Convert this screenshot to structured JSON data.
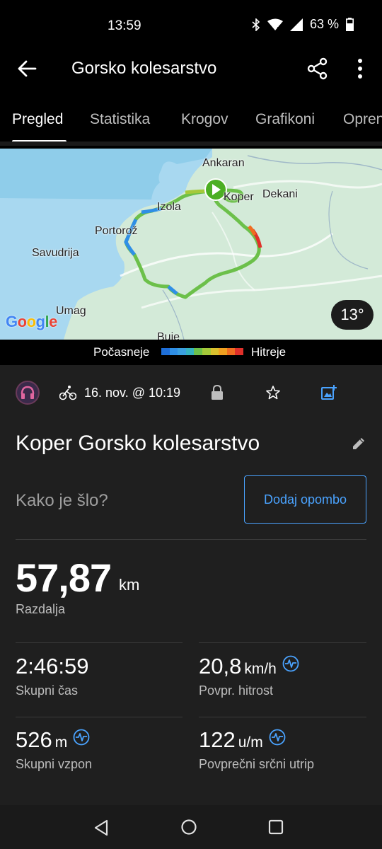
{
  "status_bar": {
    "time": "13:59",
    "battery": "63 %",
    "icons": [
      "bluetooth-icon",
      "wifi-icon",
      "signal-icon",
      "battery-icon"
    ]
  },
  "app_bar": {
    "title": "Gorsko kolesarstvo",
    "icons": [
      "back-arrow-icon",
      "share-icon",
      "more-vertical-icon"
    ]
  },
  "tabs": [
    {
      "label": "Pregled",
      "active": true
    },
    {
      "label": "Statistika",
      "active": false
    },
    {
      "label": "Krogov",
      "active": false
    },
    {
      "label": "Grafikoni",
      "active": false
    },
    {
      "label": "Opren",
      "active": false
    }
  ],
  "map": {
    "labels": {
      "ankaran": "Ankaran",
      "dekani": "Dekani",
      "izola": "Izola",
      "koper": "Koper",
      "portoroz": "Portorož",
      "savudrija": "Savudrija",
      "umag": "Umag",
      "buje": "Buje"
    },
    "google": "Google",
    "temperature": "13°"
  },
  "speed_legend": {
    "slow_label": "Počasneje",
    "fast_label": "Hitreje",
    "colors": [
      "#1e6fd9",
      "#2f8fe6",
      "#3aa0e0",
      "#35b3c0",
      "#6cc04a",
      "#a5c93a",
      "#d9c12e",
      "#f0a020",
      "#f06d20",
      "#e0302a"
    ]
  },
  "activity": {
    "date": "16. nov. @ 10:19",
    "title": "Koper Gorsko kolesarstvo",
    "how_prompt": "Kako je šlo?",
    "add_note_label": "Dodaj opombo"
  },
  "stats": {
    "distance": {
      "value": "57,87",
      "unit": "km",
      "label": "Razdalja"
    },
    "total_time": {
      "value": "2:46:59",
      "label": "Skupni čas"
    },
    "avg_speed": {
      "value": "20,8",
      "unit": "km/h",
      "label": "Povpr. hitrost"
    },
    "total_ascent": {
      "value": "526",
      "unit": "m",
      "label": "Skupni vzpon"
    },
    "avg_hr": {
      "value": "122",
      "unit": "u/m",
      "label": "Povprečni srčni utrip"
    }
  }
}
